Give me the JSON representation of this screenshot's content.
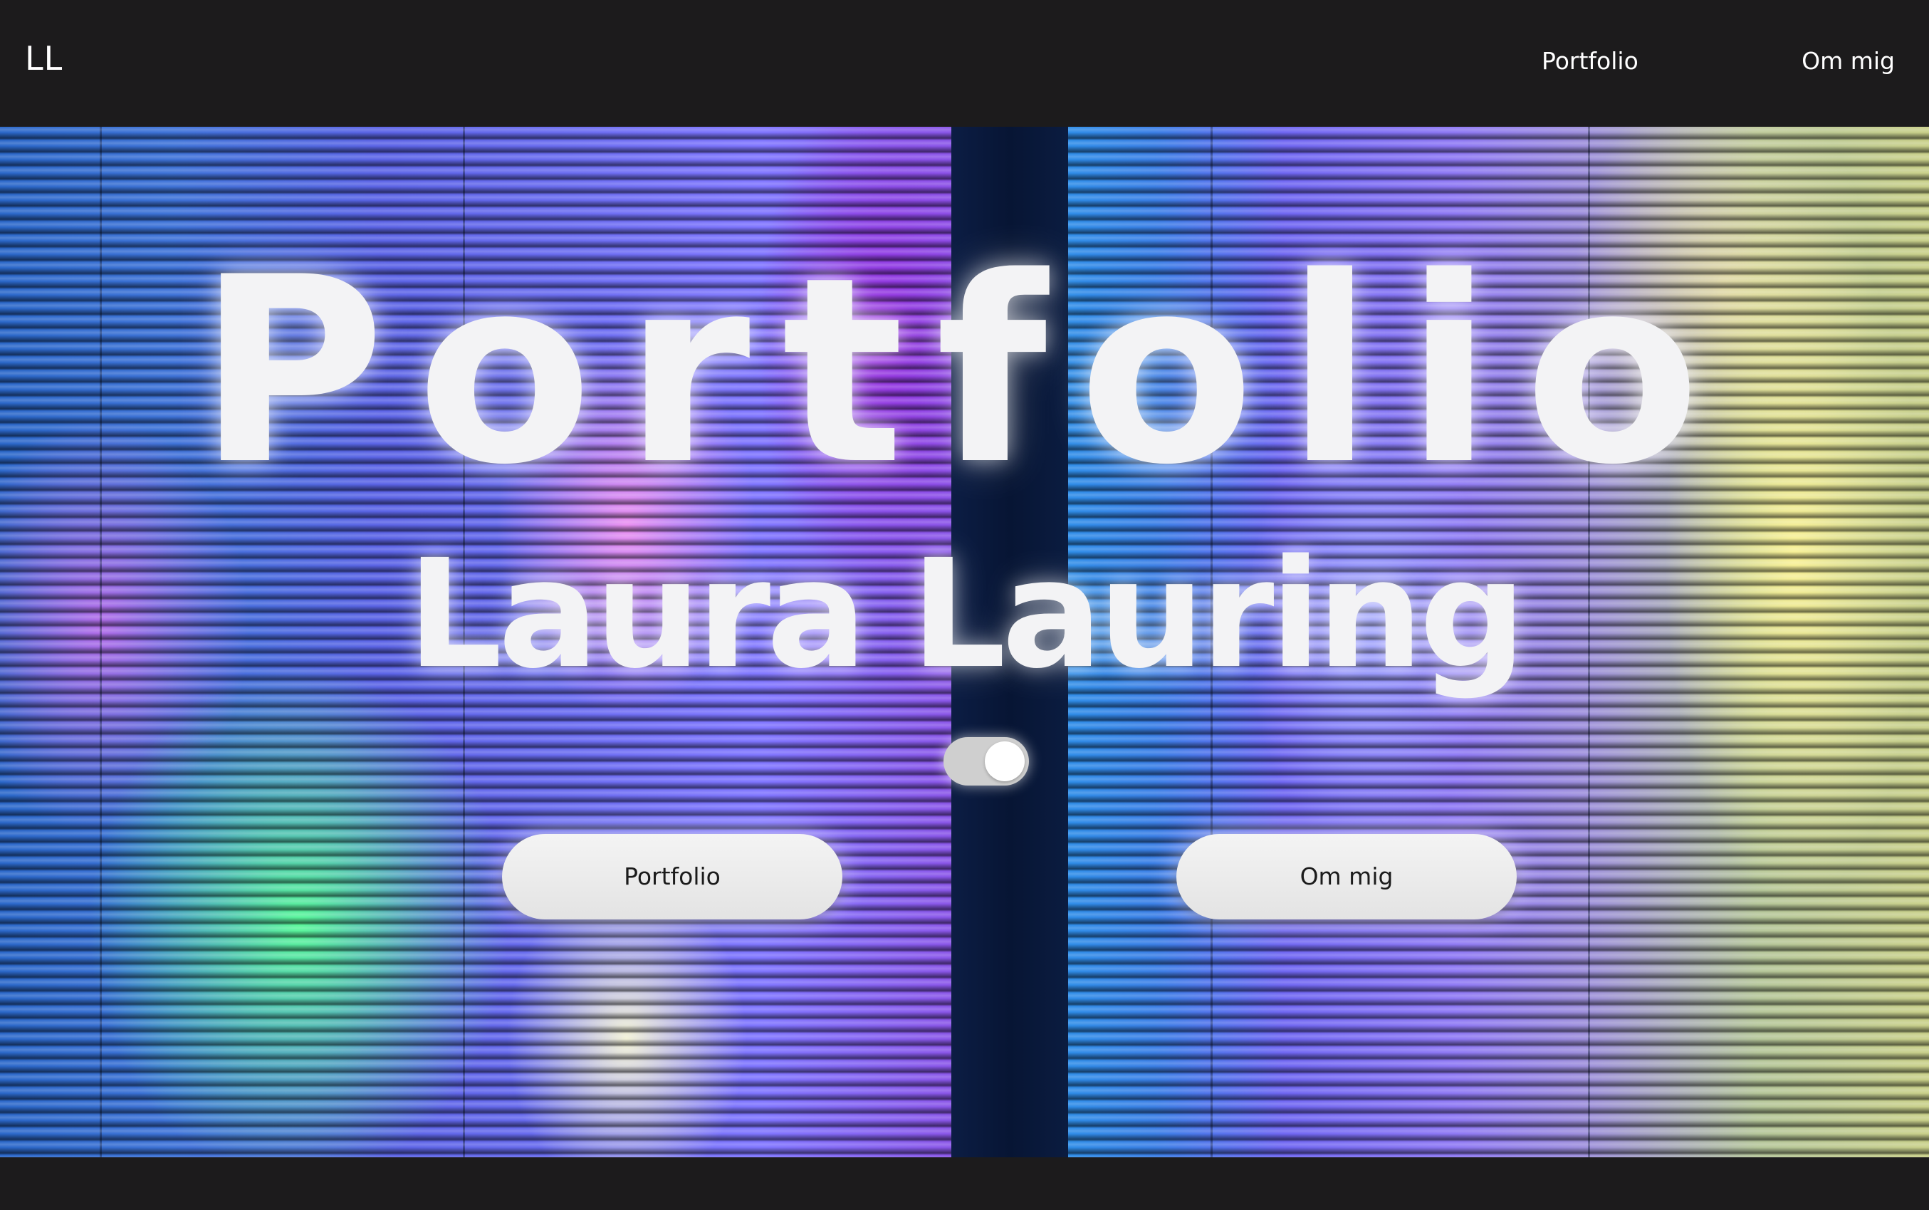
{
  "header": {
    "logo": "LL",
    "nav": [
      {
        "label": "Portfolio"
      },
      {
        "label": "Om mig"
      }
    ]
  },
  "hero": {
    "title": "Portfolio",
    "name": "Laura Lauring",
    "toggle_state": "on",
    "buttons": [
      {
        "label": "Portfolio"
      },
      {
        "label": "Om mig"
      }
    ]
  },
  "colors": {
    "header_background": "#1c1b1c",
    "text_light": "#f3f3f5",
    "button_background": "#eeeeee",
    "button_text": "#1b1b1b"
  }
}
